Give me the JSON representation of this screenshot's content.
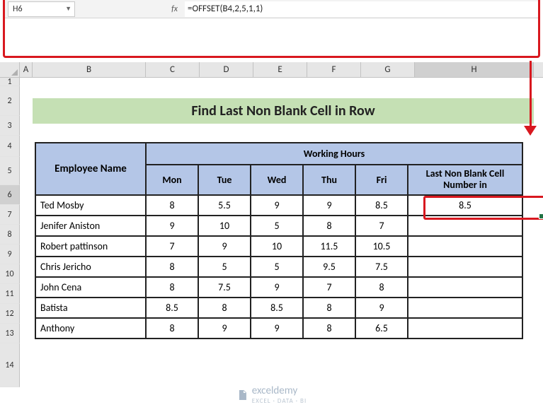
{
  "nameBox": "H6",
  "fxLabel": "fx",
  "formula": "=OFFSET(B4,2,5,1,1)",
  "columns": [
    "A",
    "B",
    "C",
    "D",
    "E",
    "F",
    "G",
    "H"
  ],
  "rows": [
    "1",
    "2",
    "3",
    "4",
    "5",
    "6",
    "7",
    "8",
    "9",
    "10",
    "11",
    "12",
    "13",
    "14"
  ],
  "title": "Find Last Non Blank Cell in Row",
  "headers": {
    "employee": "Employee Name",
    "workingHours": "Working Hours",
    "days": [
      "Mon",
      "Tue",
      "Wed",
      "Thu",
      "Fri"
    ],
    "lastNonBlank": "Last Non Blank Cell Number in"
  },
  "data": [
    {
      "name": "Ted Mosby",
      "mon": "8",
      "tue": "5.5",
      "wed": "9",
      "thu": "9",
      "fri": "8.5",
      "last": "8.5"
    },
    {
      "name": "Jenifer Aniston",
      "mon": "9",
      "tue": "10",
      "wed": "5",
      "thu": "8",
      "fri": "7",
      "last": ""
    },
    {
      "name": "Robert pattinson",
      "mon": "7",
      "tue": "9",
      "wed": "10",
      "thu": "11.5",
      "fri": "10.5",
      "last": ""
    },
    {
      "name": "Chris Jericho",
      "mon": "8",
      "tue": "5",
      "wed": "5",
      "thu": "9.5",
      "fri": "7.5",
      "last": ""
    },
    {
      "name": "John Cena",
      "mon": "8",
      "tue": "7.5",
      "wed": "9",
      "thu": "7",
      "fri": "8",
      "last": ""
    },
    {
      "name": "Batista",
      "mon": "8.5",
      "tue": "8",
      "wed": "8.5",
      "thu": "8",
      "fri": "9",
      "last": ""
    },
    {
      "name": "Anthony",
      "mon": "8",
      "tue": "9",
      "wed": "9",
      "thu": "8",
      "fri": "6.5",
      "last": ""
    }
  ],
  "logo": {
    "text": "exceldemy",
    "sub": "EXCEL · DATA · BI"
  },
  "activeCell": "H6"
}
